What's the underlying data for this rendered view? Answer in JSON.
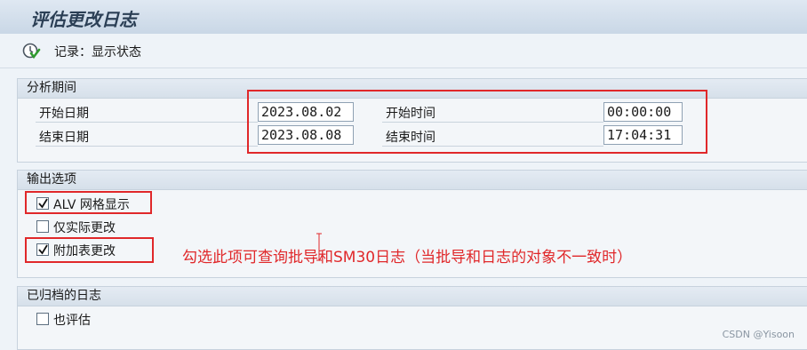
{
  "window": {
    "title": "评估更改日志"
  },
  "toolbar": {
    "status_label": "记录：显示状态",
    "status_icon": "execute-clock-icon"
  },
  "analysis_period": {
    "header": "分析期间",
    "start_date_label": "开始日期",
    "start_date_value": "2023.08.02",
    "start_time_label": "开始时间",
    "start_time_value": "00:00:00",
    "end_date_label": "结束日期",
    "end_date_value": "2023.08.08",
    "end_time_label": "结束时间",
    "end_time_value": "17:04:31"
  },
  "output_options": {
    "header": "输出选项",
    "items": [
      {
        "label": "ALV 网格显示",
        "checked": true
      },
      {
        "label": "仅实际更改",
        "checked": false
      },
      {
        "label": "附加表更改",
        "checked": true
      }
    ]
  },
  "archived_logs": {
    "header": "已归档的日志",
    "items": [
      {
        "label": "也评估",
        "checked": false
      }
    ]
  },
  "annotation": {
    "text": "勾选此项可查询批导和SM30日志（当批导和日志的对象不一致时）",
    "color": "#e0282a"
  },
  "watermark": "CSDN @Yisoon"
}
